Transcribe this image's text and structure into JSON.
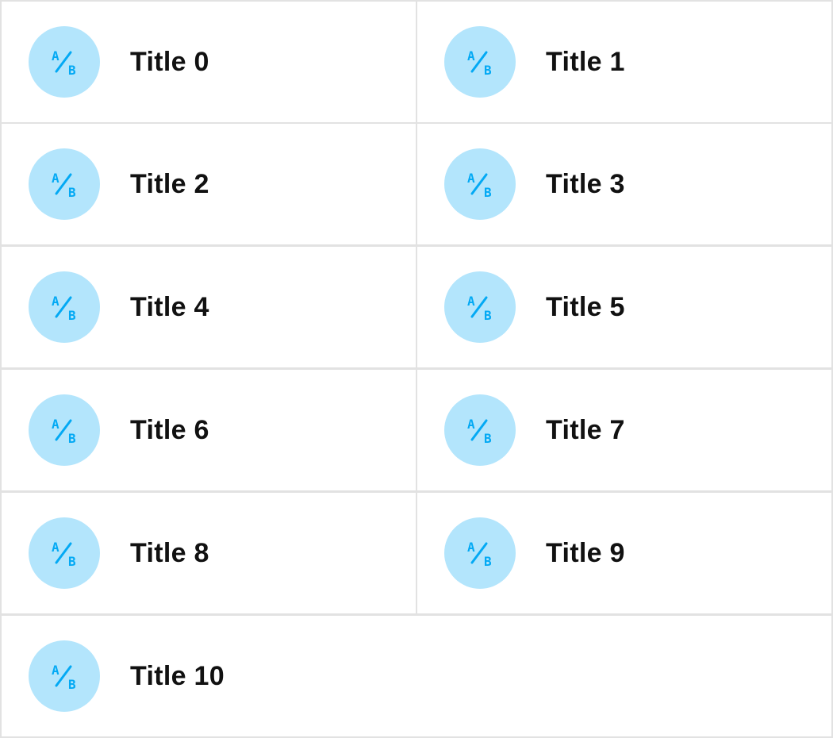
{
  "colors": {
    "icon_bg": "#b3e5fc",
    "icon_fg": "#03a9f4",
    "border": "#e2e2e2",
    "text": "#111111"
  },
  "items": [
    {
      "title": "Title 0",
      "icon": "ab-test-icon"
    },
    {
      "title": "Title 1",
      "icon": "ab-test-icon"
    },
    {
      "title": "Title 2",
      "icon": "ab-test-icon"
    },
    {
      "title": "Title 3",
      "icon": "ab-test-icon"
    },
    {
      "title": "Title 4",
      "icon": "ab-test-icon"
    },
    {
      "title": "Title 5",
      "icon": "ab-test-icon"
    },
    {
      "title": "Title 6",
      "icon": "ab-test-icon"
    },
    {
      "title": "Title 7",
      "icon": "ab-test-icon"
    },
    {
      "title": "Title 8",
      "icon": "ab-test-icon"
    },
    {
      "title": "Title 9",
      "icon": "ab-test-icon"
    },
    {
      "title": "Title 10",
      "icon": "ab-test-icon"
    }
  ]
}
